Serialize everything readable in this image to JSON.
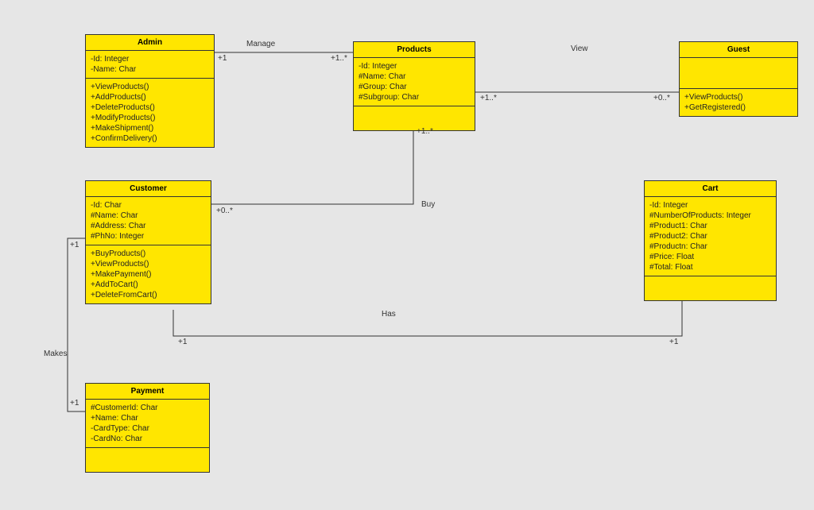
{
  "classes": {
    "admin": {
      "title": "Admin",
      "attributes": [
        "-Id: Integer",
        "-Name: Char"
      ],
      "methods": [
        "+ViewProducts()",
        "+AddProducts()",
        "+DeleteProducts()",
        "+ModifyProducts()",
        "+MakeShipment()",
        "+ConfirmDelivery()"
      ]
    },
    "products": {
      "title": "Products",
      "attributes": [
        "-Id: Integer",
        "#Name: Char",
        "#Group: Char",
        "#Subgroup: Char"
      ],
      "methods": []
    },
    "guest": {
      "title": "Guest",
      "attributes": [],
      "methods": [
        "+ViewProducts()",
        "+GetRegistered()"
      ]
    },
    "customer": {
      "title": "Customer",
      "attributes": [
        "-Id: Char",
        "#Name: Char",
        "#Address: Char",
        "#PhNo: Integer"
      ],
      "methods": [
        "+BuyProducts()",
        "+ViewProducts()",
        "+MakePayment()",
        "+AddToCart()",
        "+DeleteFromCart()"
      ]
    },
    "cart": {
      "title": "Cart",
      "attributes": [
        "-Id: Integer",
        "#NumberOfProducts: Integer",
        "#Product1: Char",
        "#Product2: Char",
        "#Productn: Char",
        "#Price: Float",
        "#Total: Float"
      ],
      "methods": []
    },
    "payment": {
      "title": "Payment",
      "attributes": [
        "#CustomerId: Char",
        "+Name: Char",
        "-CardType: Char",
        "-CardNo: Char"
      ],
      "methods": []
    }
  },
  "relations": {
    "manage": {
      "label": "Manage",
      "leftMult": "+1",
      "rightMult": "+1..*"
    },
    "view": {
      "label": "View",
      "leftMult": "+1..*",
      "rightMult": "+0..*"
    },
    "buy": {
      "label": "Buy",
      "topMult": "+1..*",
      "leftMult": "+0..*"
    },
    "has": {
      "label": "Has",
      "leftMult": "+1",
      "rightMult": "+1"
    },
    "makes": {
      "label": "Makes",
      "topMult": "+1",
      "bottomMult": "+1"
    }
  }
}
